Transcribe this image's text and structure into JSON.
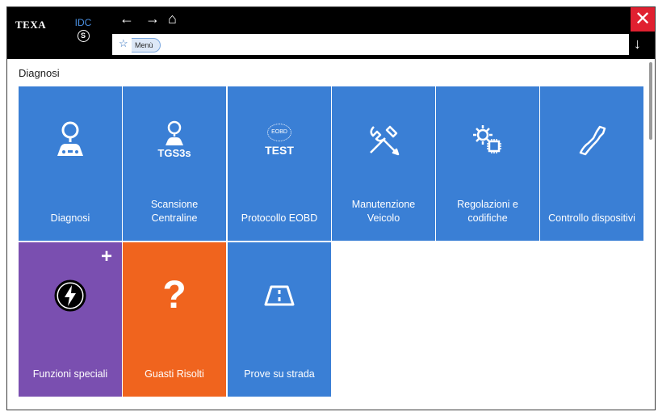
{
  "header": {
    "logo": "TEXA",
    "idc_label": "IDC",
    "idc_symbol": "S",
    "back_glyph": "←",
    "forward_glyph": "→",
    "home_glyph": "⌂",
    "close_glyph": "✕",
    "down_glyph": "↓",
    "breadcrumb": [
      "Menù"
    ]
  },
  "section": {
    "title": "Diagnosi"
  },
  "tiles": [
    {
      "label": "Diagnosi",
      "icon": "magnifier-car-icon",
      "color": "#3a7fd5"
    },
    {
      "label": "Scansione\nCentraline",
      "icon": "tgs3s-scan-icon",
      "icon_text": "TGS3s",
      "color": "#3a7fd5"
    },
    {
      "label": "Protocollo EOBD",
      "icon": "eobd-test-icon",
      "icon_text": "TEST",
      "icon_small": "EOBD",
      "color": "#3a7fd5"
    },
    {
      "label": "Manutenzione\nVeicolo",
      "icon": "wrench-screwdriver-icon",
      "color": "#3a7fd5"
    },
    {
      "label": "Regolazioni e\ncodifiche",
      "icon": "gear-chip-icon",
      "color": "#3a7fd5"
    },
    {
      "label": "Controllo dispositivi",
      "icon": "actuator-hand-icon",
      "color": "#3a7fd5"
    },
    {
      "label": "Funzioni speciali",
      "icon": "lightning-icon",
      "badge": "+",
      "color": "#7a4fb0"
    },
    {
      "label": "Guasti Risolti",
      "icon": "question-icon",
      "icon_text": "?",
      "color": "#f0641e"
    },
    {
      "label": "Prove su strada",
      "icon": "road-icon",
      "color": "#3a7fd5"
    }
  ]
}
